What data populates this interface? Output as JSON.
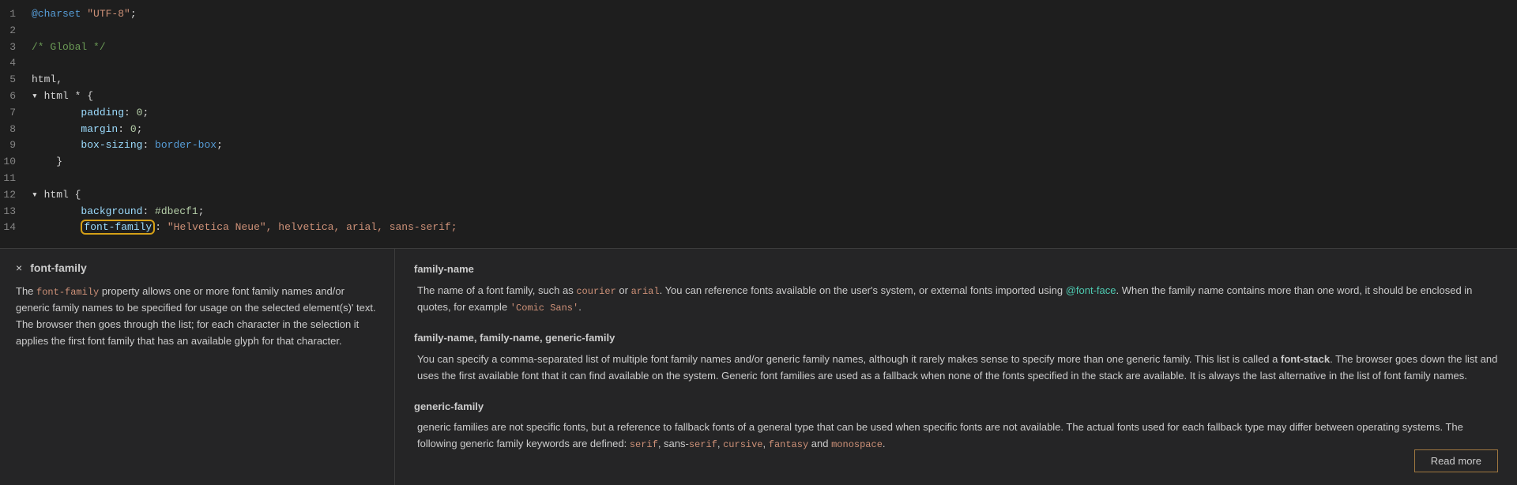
{
  "editor": {
    "lines": [
      {
        "number": "1",
        "content": [
          {
            "text": "@charset ",
            "class": "c-blue"
          },
          {
            "text": "\"UTF-8\"",
            "class": "c-orange"
          },
          {
            "text": ";",
            "class": "c-white"
          }
        ]
      },
      {
        "number": "2",
        "content": []
      },
      {
        "number": "3",
        "content": [
          {
            "text": "/* Global */",
            "class": "c-green"
          }
        ]
      },
      {
        "number": "4",
        "content": []
      },
      {
        "number": "5",
        "content": [
          {
            "text": "html,",
            "class": "c-white"
          }
        ]
      },
      {
        "number": "6",
        "content": [
          {
            "text": "▾ ",
            "class": "c-white"
          },
          {
            "text": "html",
            "class": "c-white"
          },
          {
            "text": " * {",
            "class": "c-white"
          }
        ]
      },
      {
        "number": "7",
        "content": [
          {
            "text": "        padding",
            "class": "c-cyan"
          },
          {
            "text": ": ",
            "class": "c-white"
          },
          {
            "text": "0",
            "class": "c-lime"
          },
          {
            "text": ";",
            "class": "c-white"
          }
        ]
      },
      {
        "number": "8",
        "content": [
          {
            "text": "        margin",
            "class": "c-cyan"
          },
          {
            "text": ": ",
            "class": "c-white"
          },
          {
            "text": "0",
            "class": "c-lime"
          },
          {
            "text": ";",
            "class": "c-white"
          }
        ]
      },
      {
        "number": "9",
        "content": [
          {
            "text": "        box-sizing",
            "class": "c-cyan"
          },
          {
            "text": ": ",
            "class": "c-white"
          },
          {
            "text": "border-box",
            "class": "c-blue"
          },
          {
            "text": ";",
            "class": "c-white"
          }
        ]
      },
      {
        "number": "10",
        "content": [
          {
            "text": "    }",
            "class": "c-white"
          }
        ]
      },
      {
        "number": "11",
        "content": []
      },
      {
        "number": "12",
        "content": [
          {
            "text": "▾ ",
            "class": "c-white"
          },
          {
            "text": "html",
            "class": "c-white"
          },
          {
            "text": " {",
            "class": "c-white"
          }
        ]
      },
      {
        "number": "13",
        "content": [
          {
            "text": "        background",
            "class": "c-cyan"
          },
          {
            "text": ": ",
            "class": "c-white"
          },
          {
            "text": "#dbecf1",
            "class": "c-lime"
          },
          {
            "text": ";",
            "class": "c-white"
          }
        ]
      },
      {
        "number": "14",
        "content": [
          {
            "text": "        ",
            "class": "c-white"
          },
          {
            "text": "font-family",
            "class": "c-cyan",
            "highlighted": true
          },
          {
            "text": ": ",
            "class": "c-white"
          },
          {
            "text": "\"Helvetica Neue\", helvetica, arial, sans-serif;",
            "class": "c-orange"
          }
        ]
      }
    ]
  },
  "tooltip": {
    "close_label": "×",
    "title": "font-family",
    "body": "The font-family property allows one or more font family names and/or generic family names to be specified for usage on the selected element(s)' text. The browser then goes through the list; for each character in the selection it applies the first font family that has an available glyph for that character."
  },
  "docs": {
    "sections": [
      {
        "title": "family-name",
        "body": "The name of a font family, such as courier or arial. You can reference fonts available on the user's system, or external fonts imported using @font-face. When the family name contains more than one word, it should be enclosed in quotes, for example 'Comic Sans'.",
        "link_text": "@font-face"
      },
      {
        "title": "family-name, family-name, generic-family",
        "body": "You can specify a comma-separated list of multiple font family names and/or generic family names, although it rarely makes sense to specify more than one generic family. This list is called a font-stack. The browser goes down the list and uses the first available font that it can find available on the system. Generic font families are used as a fallback when none of the fonts specified in the stack are available. It is always the last alternative in the list of font family names."
      },
      {
        "title": "generic-family",
        "body": "generic families are not specific fonts, but a reference to fallback fonts of a general type that can be used when specific fonts are not available. The actual fonts used for each fallback type may differ between operating systems. The following generic family keywords are defined: serif, sans-serif, cursive, fantasy and monospace."
      }
    ],
    "read_more_label": "Read more"
  }
}
